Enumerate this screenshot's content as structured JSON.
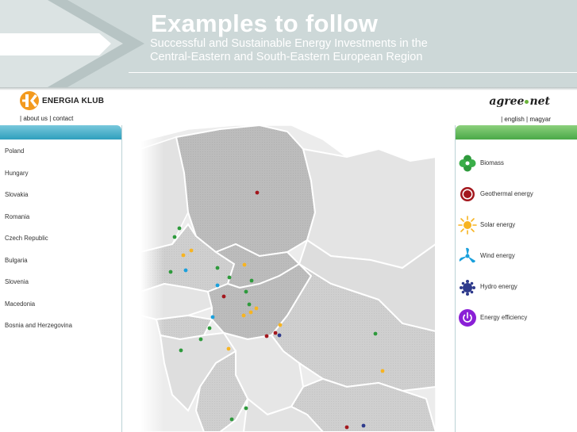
{
  "header": {
    "title": "Examples to follow",
    "subtitle": " Successful and Sustainable Energy Investments in the\nCentral-Eastern and South-Eastern European Region"
  },
  "logos": {
    "left_name": "ENERGIA KLUB",
    "right_name_a": "agree",
    "right_name_b": "net"
  },
  "links_left": {
    "sep1": "| ",
    "about": "about us",
    "sep2": " | ",
    "contact": "contact"
  },
  "links_right": {
    "sep1": "| ",
    "english": "english",
    "sep2": " | ",
    "magyar": "magyar"
  },
  "countries": [
    "Poland",
    "Hungary",
    "Slovakia",
    "Romania",
    "Czech Republic",
    "Bulgaria",
    "Slovenia",
    "Macedonia",
    "Bosnia and Herzegovina"
  ],
  "energy_types": [
    {
      "label": "Biomass",
      "icon": "biomass-icon",
      "color": "#2e9a3c"
    },
    {
      "label": "Geothermal energy",
      "icon": "geothermal-icon",
      "color": "#a3171d"
    },
    {
      "label": "Solar energy",
      "icon": "solar-icon",
      "color": "#f7b421"
    },
    {
      "label": "Wind energy",
      "icon": "wind-icon",
      "color": "#1aa0dc"
    },
    {
      "label": "Hydro energy",
      "icon": "hydro-icon",
      "color": "#2e3a8c"
    },
    {
      "label": "Energy efficiency",
      "icon": "power-icon",
      "color": "#8a1fd6"
    }
  ],
  "colors": {
    "banner": "#cdd8d8",
    "left_panel_head": "#2f9fbd",
    "right_panel_head": "#4aa948",
    "map_land": "#d2d2d2",
    "map_highlight": "#bdbdbd",
    "map_border": "#ffffff"
  }
}
